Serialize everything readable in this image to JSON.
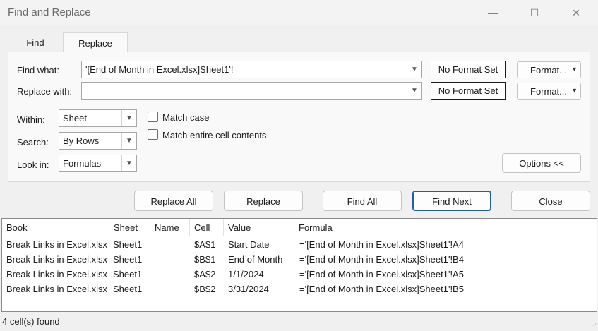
{
  "window": {
    "title": "Find and Replace",
    "minimize": "—",
    "maximize": "☐",
    "close": "✕"
  },
  "tabs": [
    {
      "label": "Find"
    },
    {
      "label": "Replace"
    }
  ],
  "find": {
    "label": "Find what:",
    "value": "'[End of Month in Excel.xlsx]Sheet1'!",
    "format_status": "No Format Set",
    "format_button": "Format..."
  },
  "replace": {
    "label": "Replace with:",
    "value": "",
    "format_status": "No Format Set",
    "format_button": "Format..."
  },
  "options": {
    "within": {
      "label": "Within:",
      "value": "Sheet"
    },
    "search": {
      "label": "Search:",
      "value": "By Rows"
    },
    "look_in": {
      "label": "Look in:",
      "value": "Formulas"
    },
    "match_case": {
      "label": "Match case",
      "checked": false
    },
    "match_entire": {
      "label": "Match entire cell contents",
      "checked": false
    },
    "options_button": "Options <<"
  },
  "buttons": {
    "replace_all": "Replace All",
    "replace": "Replace",
    "find_all": "Find All",
    "find_next": "Find Next",
    "close": "Close"
  },
  "results": {
    "columns": [
      "Book",
      "Sheet",
      "Name",
      "Cell",
      "Value",
      "Formula"
    ],
    "rows": [
      {
        "book": "Break Links in Excel.xlsx",
        "sheet": "Sheet1",
        "name": "",
        "cell": "$A$1",
        "value": "Start Date",
        "formula": "='[End of Month in Excel.xlsx]Sheet1'!A4"
      },
      {
        "book": "Break Links in Excel.xlsx",
        "sheet": "Sheet1",
        "name": "",
        "cell": "$B$1",
        "value": "End of Month",
        "formula": "='[End of Month in Excel.xlsx]Sheet1'!B4"
      },
      {
        "book": "Break Links in Excel.xlsx",
        "sheet": "Sheet1",
        "name": "",
        "cell": "$A$2",
        "value": "1/1/2024",
        "formula": "='[End of Month in Excel.xlsx]Sheet1'!A5"
      },
      {
        "book": "Break Links in Excel.xlsx",
        "sheet": "Sheet1",
        "name": "",
        "cell": "$B$2",
        "value": "3/31/2024",
        "formula": "='[End of Month in Excel.xlsx]Sheet1'!B5"
      }
    ]
  },
  "status": {
    "text": "4 cell(s) found"
  }
}
